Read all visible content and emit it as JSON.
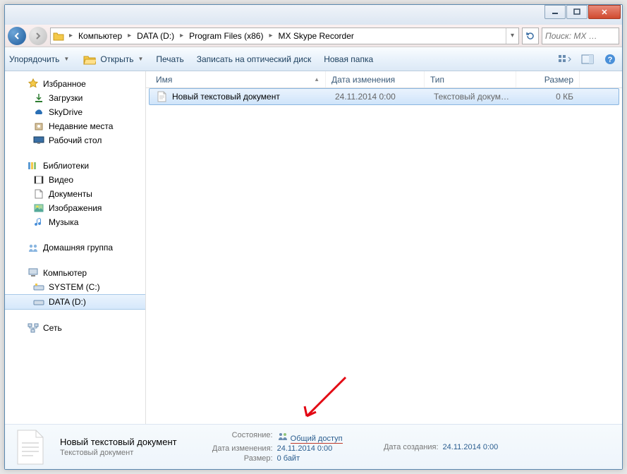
{
  "breadcrumb": [
    "Компьютер",
    "DATA (D:)",
    "Program Files (x86)",
    "MX Skype Recorder"
  ],
  "search_placeholder": "Поиск: MX …",
  "toolbar": {
    "organize": "Упорядочить",
    "open": "Открыть",
    "print": "Печать",
    "burn": "Записать на оптический диск",
    "new_folder": "Новая папка"
  },
  "sidebar": {
    "favorites": {
      "label": "Избранное",
      "items": [
        "Загрузки",
        "SkyDrive",
        "Недавние места",
        "Рабочий стол"
      ]
    },
    "libraries": {
      "label": "Библиотеки",
      "items": [
        "Видео",
        "Документы",
        "Изображения",
        "Музыка"
      ]
    },
    "homegroup": {
      "label": "Домашняя группа"
    },
    "computer": {
      "label": "Компьютер",
      "items": [
        "SYSTEM (C:)",
        "DATA (D:)"
      ]
    },
    "network": {
      "label": "Сеть"
    }
  },
  "columns": {
    "name": "Имя",
    "date": "Дата изменения",
    "type": "Тип",
    "size": "Размер"
  },
  "files": [
    {
      "name": "Новый текстовый документ",
      "date": "24.11.2014 0:00",
      "type": "Текстовый докум…",
      "size": "0 КБ"
    }
  ],
  "details": {
    "title": "Новый текстовый документ",
    "subtitle": "Текстовый документ",
    "state_label": "Состояние:",
    "state_value": "Общий доступ",
    "modified_label": "Дата изменения:",
    "modified_value": "24.11.2014 0:00",
    "size_label": "Размер:",
    "size_value": "0 байт",
    "created_label": "Дата создания:",
    "created_value": "24.11.2014 0:00"
  }
}
